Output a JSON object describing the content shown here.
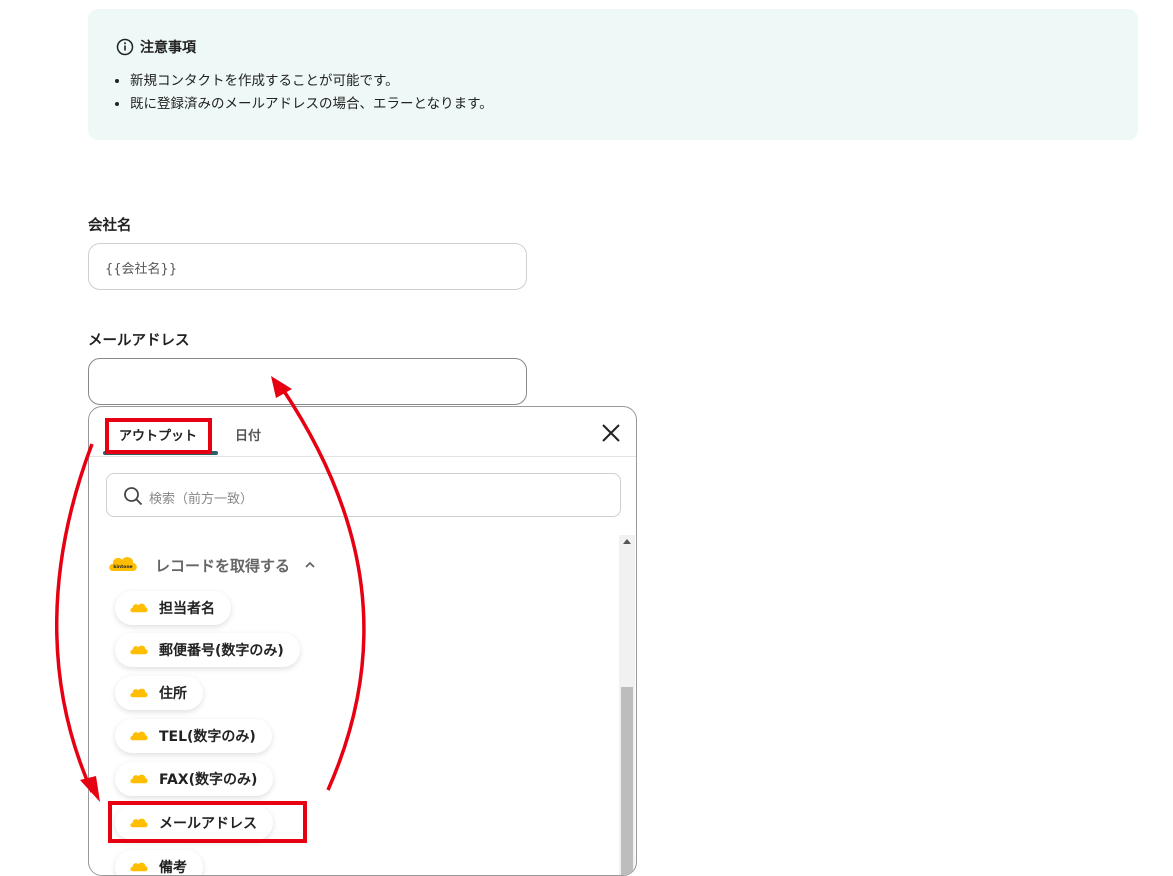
{
  "notice": {
    "title": "注意事項",
    "items": [
      "新規コンタクトを作成することが可能です。",
      "既に登録済みのメールアドレスの場合、エラーとなります。"
    ]
  },
  "fields": {
    "company": {
      "label": "会社名",
      "value": "{{会社名}}"
    },
    "email": {
      "label": "メールアドレス",
      "value": ""
    }
  },
  "dropdown": {
    "tabs": {
      "output": "アウトプット",
      "date": "日付"
    },
    "search_placeholder": "検索（前方一致）",
    "group_title": "レコードを取得する",
    "logo_text": "kintone",
    "items": [
      "担当者名",
      "郵便番号(数字のみ)",
      "住所",
      "TEL(数字のみ)",
      "FAX(数字のみ)",
      "メールアドレス",
      "備考"
    ]
  },
  "colors": {
    "highlight": "#e60012",
    "kintone": "#ffbe00",
    "notice_bg": "#eef8f6"
  }
}
